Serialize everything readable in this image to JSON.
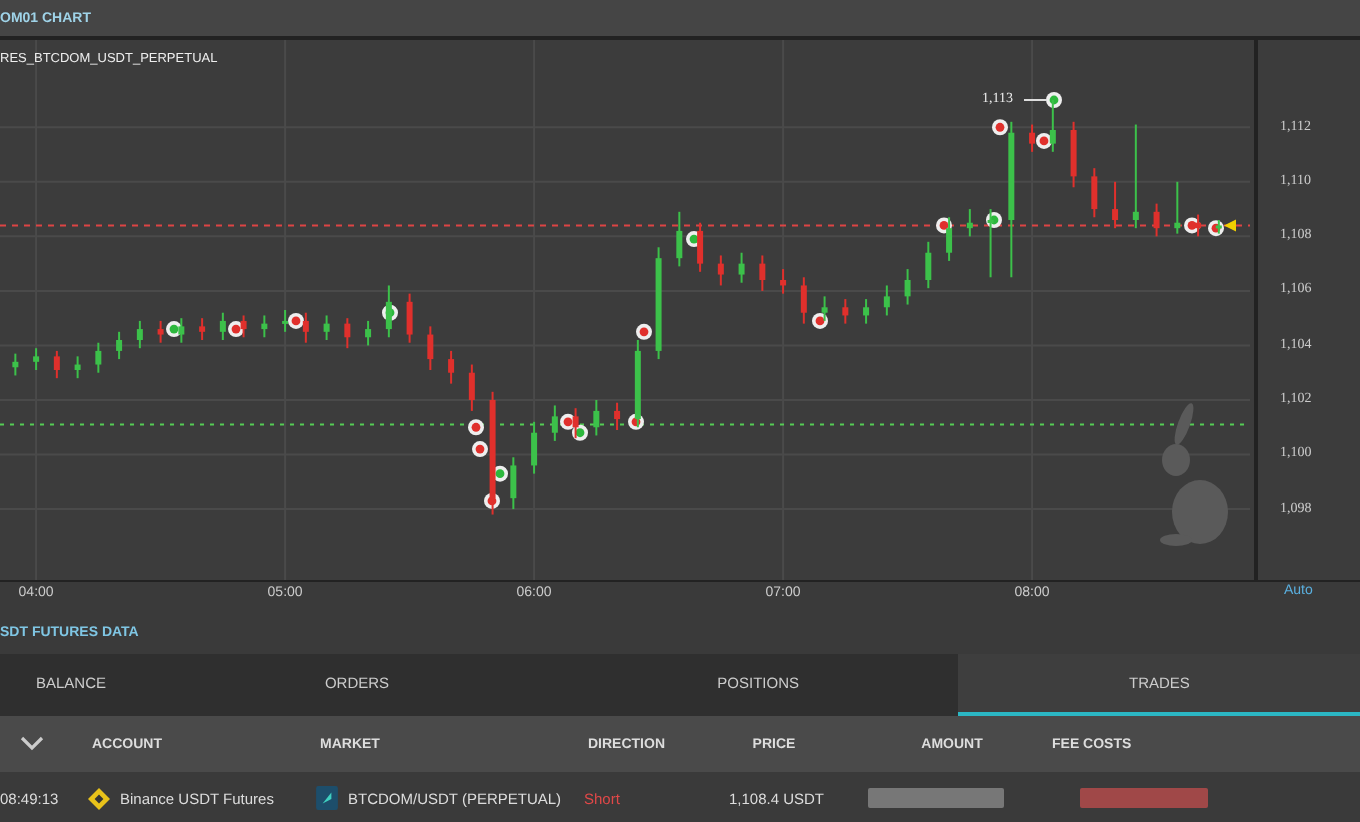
{
  "panel": {
    "title": "OM01 CHART"
  },
  "chart": {
    "symbol": "RES_BTCDOM_USDT_PERPETUAL",
    "high_label": "1,113",
    "scale_mode": "Auto",
    "chart_data": {
      "type": "candlestick",
      "xlim": [
        3.855,
        9.317
      ],
      "ylim": [
        1095.4,
        1115.2
      ],
      "grid": true,
      "ref_lines": [
        {
          "axis": "y",
          "value": 1108.4,
          "color": "#dd4444"
        },
        {
          "axis": "y",
          "value": 1101.1,
          "color": "#55cc55"
        }
      ],
      "xticks": [
        {
          "value": 4,
          "label": "04:00"
        },
        {
          "value": 5,
          "label": "05:00"
        },
        {
          "value": 6,
          "label": "06:00"
        },
        {
          "value": 7,
          "label": "07:00"
        },
        {
          "value": 8,
          "label": "08:00"
        }
      ],
      "yticks": [
        {
          "value": 1112,
          "label": "1,112"
        },
        {
          "value": 1110,
          "label": "1,110"
        },
        {
          "value": 1108,
          "label": "1,108"
        },
        {
          "value": 1106,
          "label": "1,106"
        },
        {
          "value": 1104,
          "label": "1,104"
        },
        {
          "value": 1102,
          "label": "1,102"
        },
        {
          "value": 1100,
          "label": "1,100"
        },
        {
          "value": 1098,
          "label": "1,098"
        }
      ],
      "x": [
        3.9167,
        4,
        4.0833,
        4.1667,
        4.25,
        4.3333,
        4.4167,
        4.5,
        4.5833,
        4.6667,
        4.75,
        4.8333,
        4.9167,
        5,
        5.0833,
        5.1667,
        5.25,
        5.3333,
        5.4167,
        5.5,
        5.5833,
        5.6667,
        5.75,
        5.8333,
        5.9167,
        6,
        6.0833,
        6.1667,
        6.25,
        6.3333,
        6.4167,
        6.5,
        6.5833,
        6.6667,
        6.75,
        6.8333,
        6.9167,
        7,
        7.0833,
        7.1667,
        7.25,
        7.3333,
        7.4167,
        7.5,
        7.5833,
        7.6667,
        7.75,
        7.8333,
        7.9167,
        8,
        8.0833,
        8.1667,
        8.25,
        8.3333,
        8.4167,
        8.5,
        8.5833,
        8.6667,
        8.75
      ],
      "ohlc": [
        [
          1103.2,
          1103.7,
          1102.9,
          1103.4
        ],
        [
          1103.4,
          1103.9,
          1103.1,
          1103.6
        ],
        [
          1103.6,
          1103.8,
          1102.8,
          1103.1
        ],
        [
          1103.1,
          1103.6,
          1102.8,
          1103.3
        ],
        [
          1103.3,
          1104.1,
          1103.0,
          1103.8
        ],
        [
          1103.8,
          1104.5,
          1103.5,
          1104.2
        ],
        [
          1104.2,
          1104.9,
          1103.9,
          1104.6
        ],
        [
          1104.6,
          1104.9,
          1104.1,
          1104.4
        ],
        [
          1104.4,
          1105.0,
          1104.1,
          1104.7
        ],
        [
          1104.7,
          1105.0,
          1104.2,
          1104.5
        ],
        [
          1104.5,
          1105.2,
          1104.2,
          1104.9
        ],
        [
          1104.9,
          1105.1,
          1104.3,
          1104.6
        ],
        [
          1104.6,
          1105.1,
          1104.3,
          1104.8
        ],
        [
          1104.8,
          1105.3,
          1104.5,
          1104.9
        ],
        [
          1104.9,
          1105.2,
          1104.1,
          1104.5
        ],
        [
          1104.5,
          1105.1,
          1104.2,
          1104.8
        ],
        [
          1104.8,
          1105.0,
          1103.9,
          1104.3
        ],
        [
          1104.3,
          1104.9,
          1104.0,
          1104.6
        ],
        [
          1104.6,
          1106.2,
          1104.3,
          1105.6
        ],
        [
          1105.6,
          1105.9,
          1104.1,
          1104.4
        ],
        [
          1104.4,
          1104.7,
          1103.1,
          1103.5
        ],
        [
          1103.5,
          1103.8,
          1102.6,
          1103.0
        ],
        [
          1103.0,
          1103.3,
          1101.6,
          1102.0
        ],
        [
          1102.0,
          1102.3,
          1097.8,
          1098.4
        ],
        [
          1098.4,
          1099.9,
          1098.0,
          1099.6
        ],
        [
          1099.6,
          1101.2,
          1099.3,
          1100.8
        ],
        [
          1100.8,
          1101.8,
          1100.5,
          1101.4
        ],
        [
          1101.4,
          1101.7,
          1100.6,
          1101.0
        ],
        [
          1101.0,
          1102.0,
          1100.7,
          1101.6
        ],
        [
          1101.6,
          1101.9,
          1100.9,
          1101.3
        ],
        [
          1101.3,
          1104.2,
          1101.0,
          1103.8
        ],
        [
          1103.8,
          1107.6,
          1103.5,
          1107.2
        ],
        [
          1107.2,
          1108.9,
          1106.9,
          1108.2
        ],
        [
          1108.2,
          1108.5,
          1106.7,
          1107.0
        ],
        [
          1107.0,
          1107.3,
          1106.2,
          1106.6
        ],
        [
          1106.6,
          1107.4,
          1106.3,
          1107.0
        ],
        [
          1107.0,
          1107.3,
          1106.0,
          1106.4
        ],
        [
          1106.4,
          1106.8,
          1105.9,
          1106.2
        ],
        [
          1106.2,
          1106.5,
          1104.8,
          1105.2
        ],
        [
          1105.2,
          1105.8,
          1104.9,
          1105.4
        ],
        [
          1105.4,
          1105.7,
          1104.8,
          1105.1
        ],
        [
          1105.1,
          1105.7,
          1104.8,
          1105.4
        ],
        [
          1105.4,
          1106.2,
          1105.1,
          1105.8
        ],
        [
          1105.8,
          1106.8,
          1105.5,
          1106.4
        ],
        [
          1106.4,
          1107.8,
          1106.1,
          1107.4
        ],
        [
          1107.4,
          1108.7,
          1107.1,
          1108.3
        ],
        [
          1108.3,
          1109.0,
          1108.0,
          1108.5
        ],
        [
          1108.5,
          1109.0,
          1106.5,
          1108.6
        ],
        [
          1108.6,
          1112.2,
          1106.5,
          1111.8
        ],
        [
          1111.8,
          1112.1,
          1111.1,
          1111.4
        ],
        [
          1111.4,
          1113.0,
          1111.1,
          1111.9
        ],
        [
          1111.9,
          1112.2,
          1109.8,
          1110.2
        ],
        [
          1110.2,
          1110.5,
          1108.7,
          1109.0
        ],
        [
          1109.0,
          1110.0,
          1108.3,
          1108.6
        ],
        [
          1108.6,
          1112.1,
          1108.3,
          1108.9
        ],
        [
          1108.9,
          1109.2,
          1108.0,
          1108.3
        ],
        [
          1108.3,
          1110.0,
          1108.1,
          1108.5
        ],
        [
          1108.5,
          1108.8,
          1108.0,
          1108.3
        ],
        [
          1108.3,
          1108.6,
          1108.1,
          1108.4
        ]
      ]
    }
  },
  "data_panel": {
    "title": "SDT FUTURES DATA"
  },
  "tabs": [
    {
      "label": "BALANCE",
      "selected": false
    },
    {
      "label": "ORDERS",
      "selected": false
    },
    {
      "label": "POSITIONS",
      "selected": false
    },
    {
      "label": "TRADES",
      "selected": true
    }
  ],
  "table": {
    "columns": [
      "ACCOUNT",
      "MARKET",
      "DIRECTION",
      "PRICE",
      "AMOUNT",
      "FEE COSTS"
    ],
    "rows": [
      {
        "time": "08:49:13",
        "account": "Binance USDT Futures",
        "market": "BTCDOM/USDT (PERPETUAL)",
        "direction": "Short",
        "price": "1,108.4 USDT"
      }
    ]
  }
}
